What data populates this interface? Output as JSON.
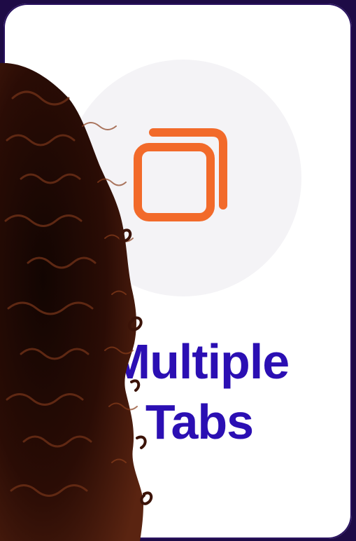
{
  "card": {
    "title_line1": "Multiple",
    "title_line2": "Tabs",
    "icon": "multiple-tabs-icon"
  },
  "colors": {
    "background": "#1e0b46",
    "card": "#ffffff",
    "icon_circle": "#f4f3f6",
    "icon": "#f26a2a",
    "title": "#2b0fb3"
  },
  "photo": {
    "subject": "curly-hair"
  }
}
